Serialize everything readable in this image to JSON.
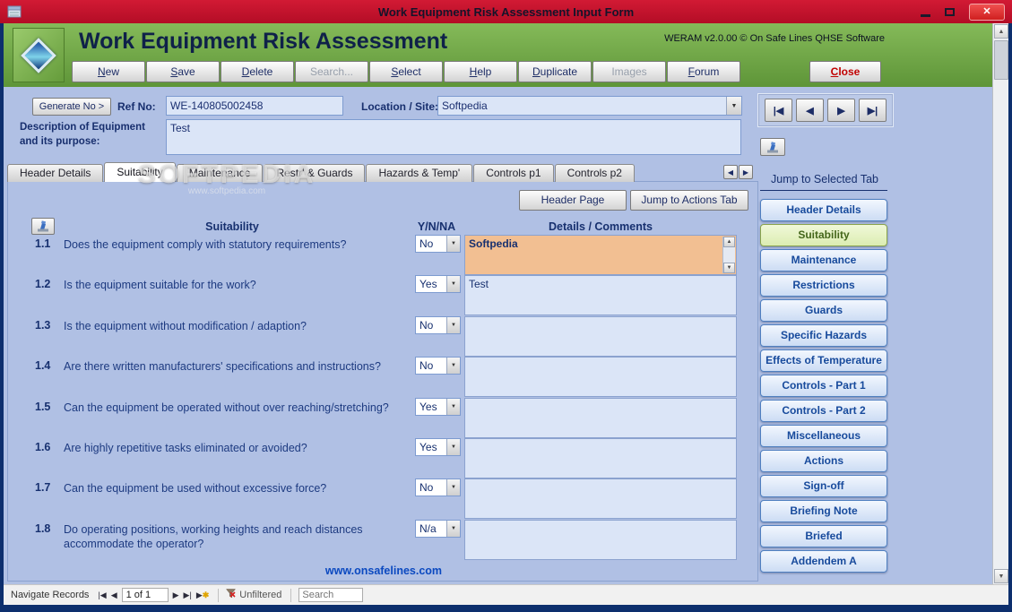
{
  "window": {
    "title": "Work Equipment Risk Assessment Input Form"
  },
  "branding": {
    "app_title": "Work Equipment Risk Assessment",
    "version_text": "WERAM v2.0.00 © On Safe Lines QHSE Software"
  },
  "toolbar": {
    "buttons": [
      {
        "label": "New",
        "enabled": true
      },
      {
        "label": "Save",
        "enabled": true
      },
      {
        "label": "Delete",
        "enabled": true
      },
      {
        "label": "Search...",
        "enabled": false
      },
      {
        "label": "Select",
        "enabled": true
      },
      {
        "label": "Help",
        "enabled": true
      },
      {
        "label": "Duplicate",
        "enabled": true
      },
      {
        "label": "Images",
        "enabled": false
      },
      {
        "label": "Forum",
        "enabled": true
      }
    ],
    "close_label": "Close"
  },
  "form_header": {
    "generate_label": "Generate No >",
    "ref_label": "Ref No:",
    "ref_value": "WE-140805002458",
    "location_label": "Location / Site:",
    "location_value": "Softpedia",
    "description_label": "Description of Equipment and its purpose:",
    "description_value": "Test"
  },
  "tabs": {
    "items": [
      "Header Details",
      "Suitability",
      "Maintenance",
      "Restr' & Guards",
      "Hazards & Temp'",
      "Controls p1",
      "Controls p2"
    ],
    "active": "Suitability"
  },
  "page": {
    "header_page_label": "Header Page",
    "jump_actions_label": "Jump to Actions Tab",
    "columns": {
      "question": "Suitability",
      "answer": "Y/N/NA",
      "details": "Details / Comments"
    },
    "rows": [
      {
        "num": "1.1",
        "question": "Does the equipment comply with statutory requirements?",
        "answer": "No",
        "comment": "Softpedia",
        "highlighted": true
      },
      {
        "num": "1.2",
        "question": "Is the equipment suitable for the work?",
        "answer": "Yes",
        "comment": "Test",
        "highlighted": false
      },
      {
        "num": "1.3",
        "question": "Is the equipment without modification / adaption?",
        "answer": "No",
        "comment": "",
        "highlighted": false
      },
      {
        "num": "1.4",
        "question": "Are there written manufacturers' specifications and instructions?",
        "answer": "No",
        "comment": "",
        "highlighted": false
      },
      {
        "num": "1.5",
        "question": "Can the equipment be operated without over reaching/stretching?",
        "answer": "Yes",
        "comment": "",
        "highlighted": false
      },
      {
        "num": "1.6",
        "question": "Are highly repetitive tasks eliminated or avoided?",
        "answer": "Yes",
        "comment": "",
        "highlighted": false
      },
      {
        "num": "1.7",
        "question": "Can the equipment be used without excessive force?",
        "answer": "No",
        "comment": "",
        "highlighted": false
      },
      {
        "num": "1.8",
        "question": "Do operating positions, working heights and reach distances accommodate the operator?",
        "answer": "N/a",
        "comment": "",
        "highlighted": false
      }
    ],
    "footer_link": "www.onsafelines.com"
  },
  "sidebar": {
    "title": "Jump to Selected Tab",
    "active": "Suitability",
    "items": [
      "Header Details",
      "Suitability",
      "Maintenance",
      "Restrictions",
      "Guards",
      "Specific Hazards",
      "Effects of Temperature",
      "Controls - Part 1",
      "Controls - Part 2",
      "Miscellaneous",
      "Actions",
      "Sign-off",
      "Briefing Note",
      "Briefed",
      "Addendem A"
    ]
  },
  "statusbar": {
    "navigate_label": "Navigate Records",
    "record_value": "1 of 1",
    "filter_label": "Unfiltered",
    "search_placeholder": "Search"
  },
  "watermark": {
    "line1": "SOFTPEDIA",
    "line2": "www.softpedia.com"
  },
  "colors": {
    "titlebar_red": "#c11530",
    "header_green": "#74ab49",
    "panel_periwinkle": "#b0c0e4",
    "highlight_orange": "#f2bf92",
    "active_nav_green": "#e3f0ba",
    "link_blue": "#0b49c0"
  }
}
